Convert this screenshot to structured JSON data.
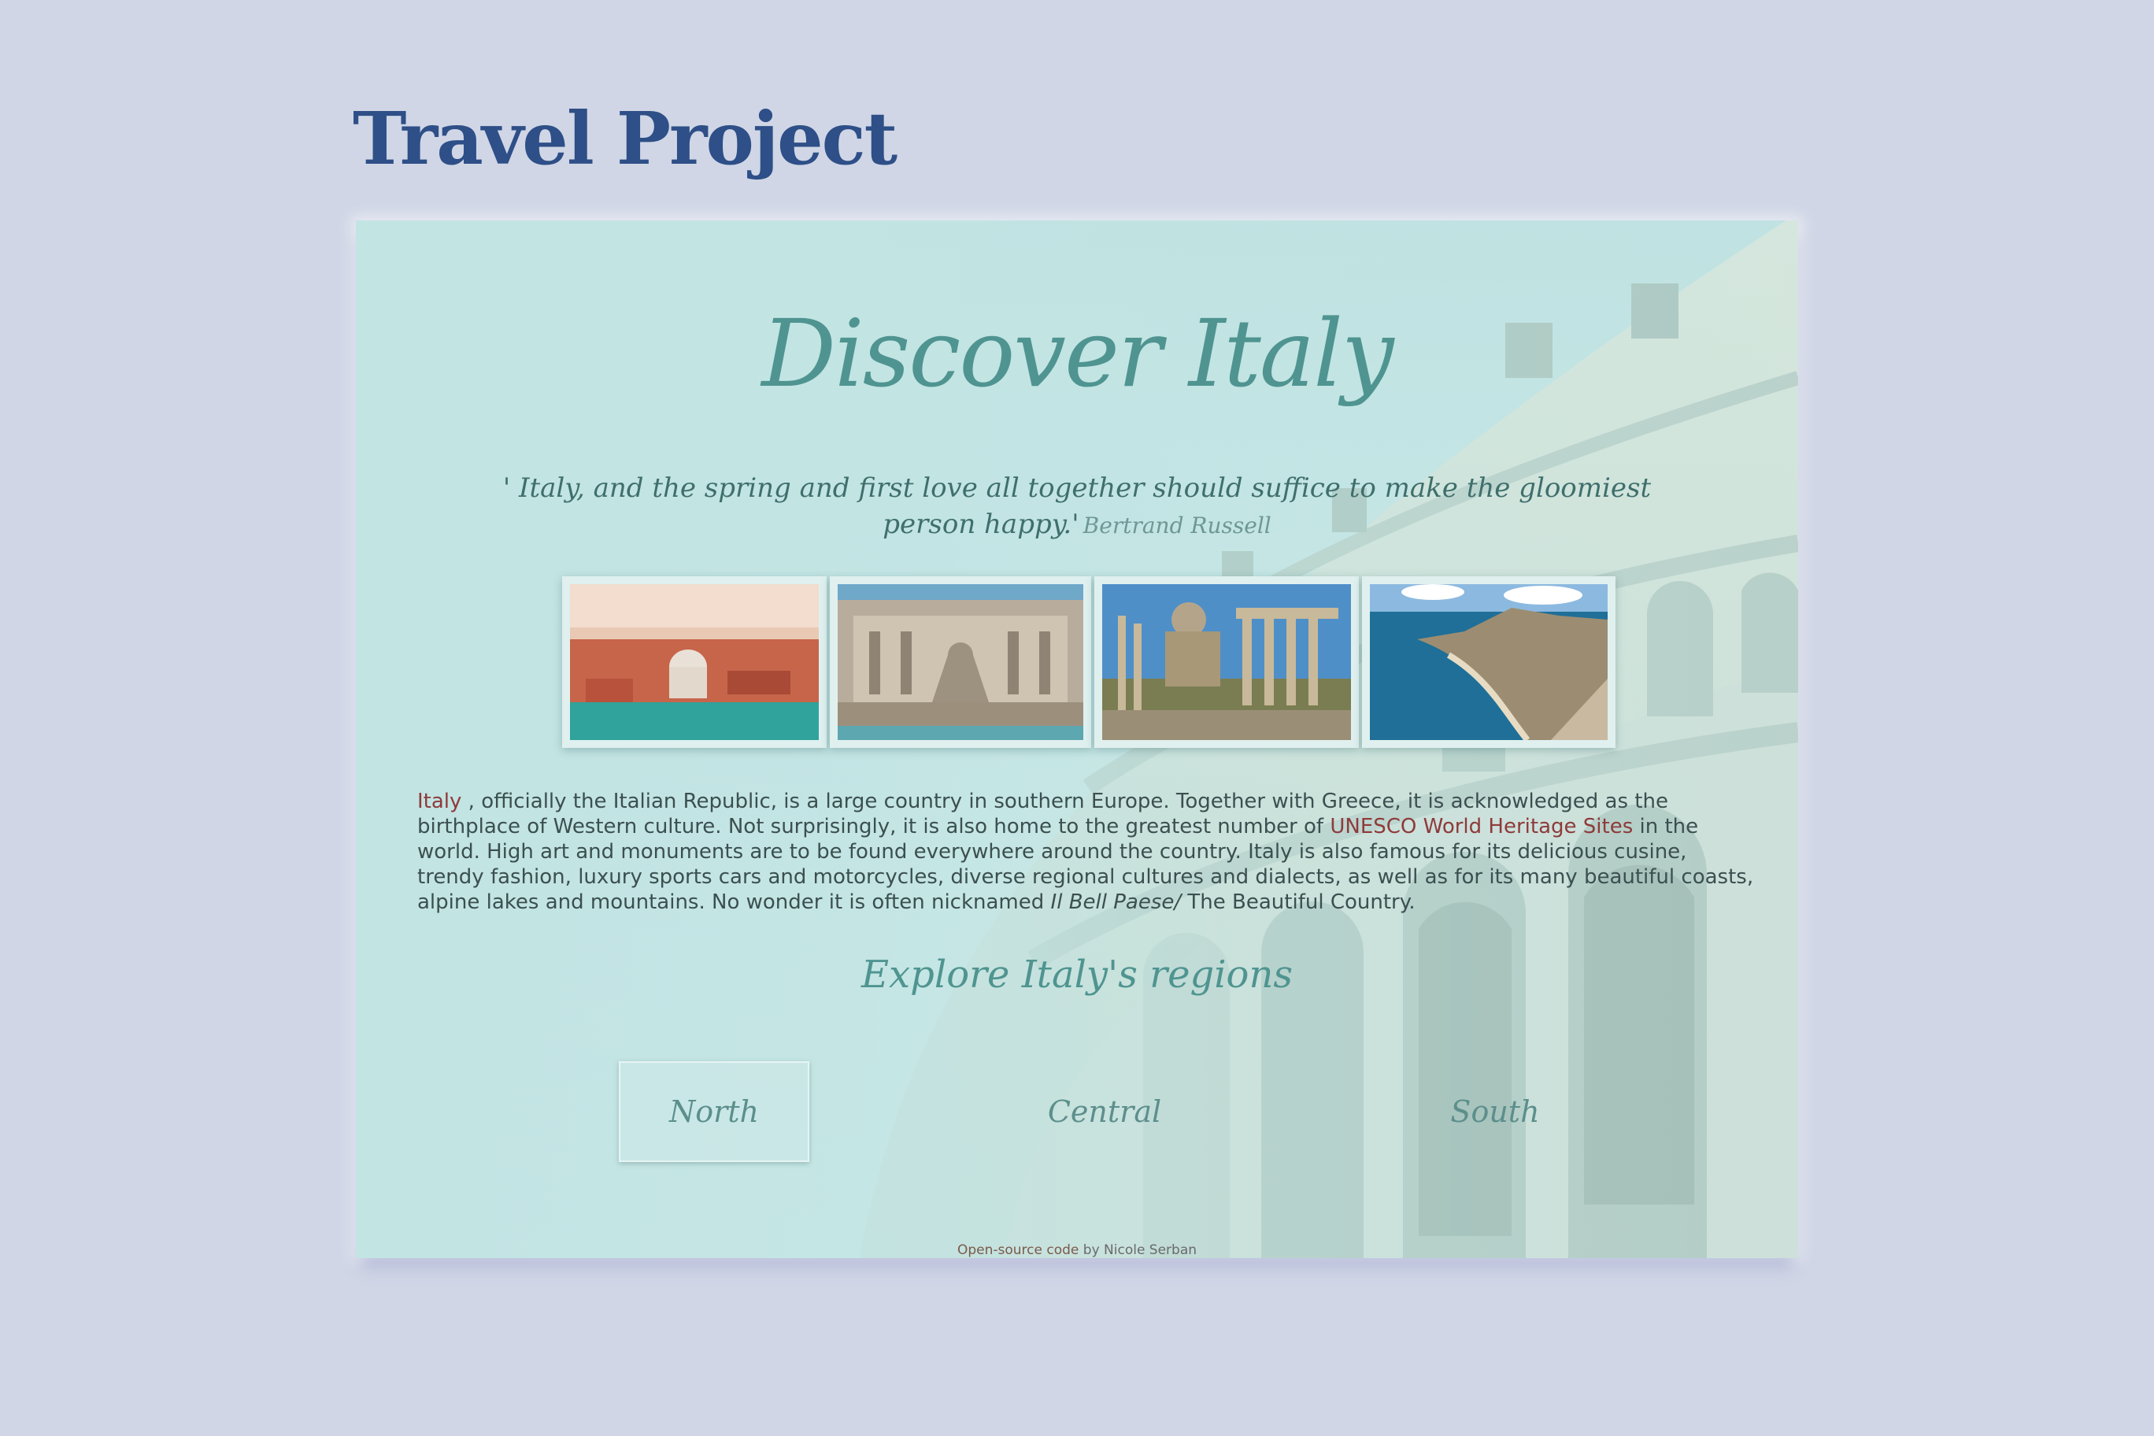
{
  "page": {
    "title": "Travel Project"
  },
  "hero": {
    "title": "Discover Italy",
    "quote": "' Italy, and the spring and first love all together should suffice to make the gloomiest person happy.'",
    "quote_author": "Bertrand Russell"
  },
  "gallery": {
    "photos": [
      {
        "name": "venice-photo",
        "scene": "Venice aerial view"
      },
      {
        "name": "trevi-fountain-photo",
        "scene": "Trevi Fountain"
      },
      {
        "name": "roman-forum-photo",
        "scene": "Roman Forum ruins"
      },
      {
        "name": "sicily-coast-photo",
        "scene": "Sicilian coastline"
      }
    ]
  },
  "intro": {
    "italy_link": "Italy",
    "text_1": " , officially the Italian Republic, is a large country in southern Europe. Together with Greece, it is acknowledged as the birthplace of Western culture. Not surprisingly, it is also home to the greatest number of ",
    "unesco_link": "UNESCO World Heritage Sites",
    "text_2": " in the world. High art and monuments are to be found everywhere around the country. Italy is also famous for its delicious cusine, trendy fashion, luxury sports cars and motorcycles, diverse regional cultures and dialects, as well as for its many beautiful coasts, alpine lakes and mountains. No wonder it is often nicknamed ",
    "nickname": "Il Bell Paese/",
    "text_3": " The Beautiful Country."
  },
  "regions": {
    "heading": "Explore Italy's regions",
    "buttons": [
      "North",
      "Central",
      "South"
    ],
    "active": "North"
  },
  "footer": {
    "link_text": "Open-source code",
    "by_text": " by Nicole Serban"
  },
  "colors": {
    "background": "#d0d6e6",
    "title": "#2e4f87",
    "accent_teal": "#4f9490",
    "link_red": "#8e3a3a"
  }
}
